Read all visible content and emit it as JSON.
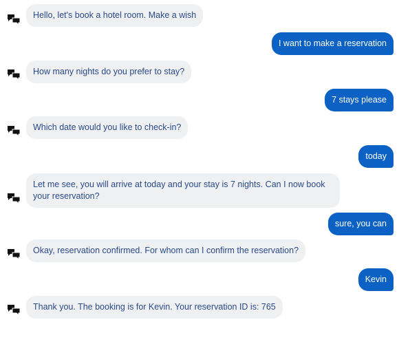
{
  "conversation": {
    "messages": [
      {
        "sender": "bot",
        "text": "Hello, let's book a hotel room. Make a wish"
      },
      {
        "sender": "user",
        "text": "I want to make a reservation"
      },
      {
        "sender": "bot",
        "text": "How many nights do you prefer to stay?"
      },
      {
        "sender": "user",
        "text": "7 stays please"
      },
      {
        "sender": "bot",
        "text": "Which date would you like to check-in?"
      },
      {
        "sender": "user",
        "text": "today"
      },
      {
        "sender": "bot",
        "text": "Let me see, you will arrive at today and your stay is 7 nights. Can I now book your reservation?"
      },
      {
        "sender": "user",
        "text": "sure, you can"
      },
      {
        "sender": "bot",
        "text": "Okay, reservation confirmed. For whom can I confirm the reservation?"
      },
      {
        "sender": "user",
        "text": "Kevin"
      },
      {
        "sender": "bot",
        "text": "Thank you. The booking is for Kevin. Your reservation ID is: 765"
      }
    ]
  },
  "icons": {
    "bot_avatar": "chat-bubbles-icon"
  },
  "colors": {
    "user_bubble": "#0b61c4",
    "bot_bubble": "#eff0f2",
    "bot_text": "#2a4a8a"
  }
}
